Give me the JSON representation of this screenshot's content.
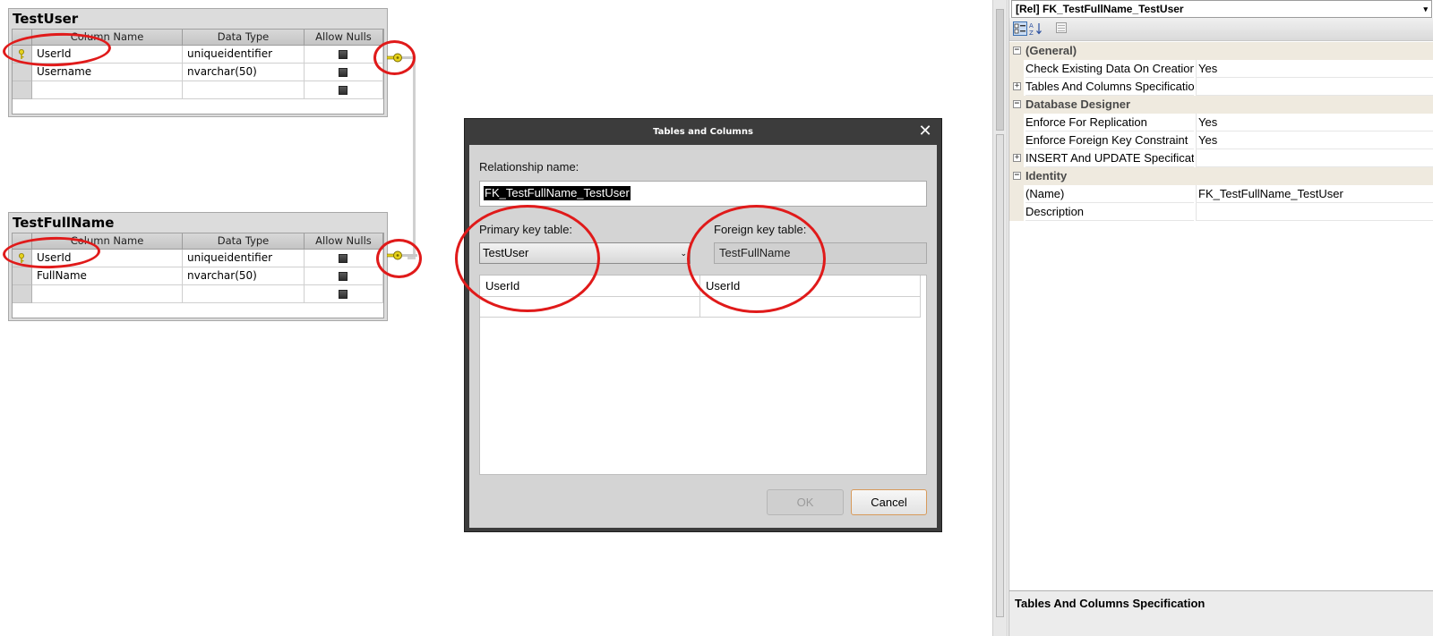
{
  "tables": [
    {
      "name": "TestUser",
      "headers": [
        "Column Name",
        "Data Type",
        "Allow Nulls"
      ],
      "rows": [
        {
          "column": "UserId",
          "type": "uniqueidentifier",
          "primary_key": true
        },
        {
          "column": "Username",
          "type": "nvarchar(50)",
          "primary_key": false
        },
        {
          "column": "",
          "type": "",
          "primary_key": false
        }
      ]
    },
    {
      "name": "TestFullName",
      "headers": [
        "Column Name",
        "Data Type",
        "Allow Nulls"
      ],
      "rows": [
        {
          "column": "UserId",
          "type": "uniqueidentifier",
          "primary_key": true
        },
        {
          "column": "FullName",
          "type": "nvarchar(50)",
          "primary_key": false
        },
        {
          "column": "",
          "type": "",
          "primary_key": false
        }
      ]
    }
  ],
  "dialog": {
    "title": "Tables and Columns",
    "close_glyph": "✕",
    "relationship_label": "Relationship name:",
    "relationship_name": "FK_TestFullName_TestUser",
    "primary_label": "Primary key table:",
    "primary_table": "TestUser",
    "foreign_label": "Foreign key table:",
    "foreign_table": "TestFullName",
    "mapping": [
      {
        "primary": "UserId",
        "foreign": "UserId"
      },
      {
        "primary": "",
        "foreign": ""
      }
    ],
    "ok_label": "OK",
    "cancel_label": "Cancel"
  },
  "properties": {
    "object": "[Rel] FK_TestFullName_TestUser",
    "categories": [
      {
        "name": "(General)",
        "items": [
          {
            "name": "Check Existing Data On Creation",
            "value": "Yes",
            "expandable": false
          },
          {
            "name": "Tables And Columns Specification",
            "value": "",
            "expandable": true
          }
        ]
      },
      {
        "name": "Database Designer",
        "items": [
          {
            "name": "Enforce For Replication",
            "value": "Yes",
            "expandable": false
          },
          {
            "name": "Enforce Foreign Key Constraint",
            "value": "Yes",
            "expandable": false
          },
          {
            "name": "INSERT And UPDATE Specification",
            "value": "",
            "expandable": true
          }
        ]
      },
      {
        "name": "Identity",
        "items": [
          {
            "name": "(Name)",
            "value": "FK_TestFullName_TestUser",
            "expandable": false
          },
          {
            "name": "Description",
            "value": "",
            "expandable": false
          }
        ]
      }
    ],
    "description_title": "Tables And Columns Specification"
  },
  "colors": {
    "annotation": "#e01a1a",
    "key": "#e6d21c",
    "dialog_frame": "#3c3c3c"
  }
}
